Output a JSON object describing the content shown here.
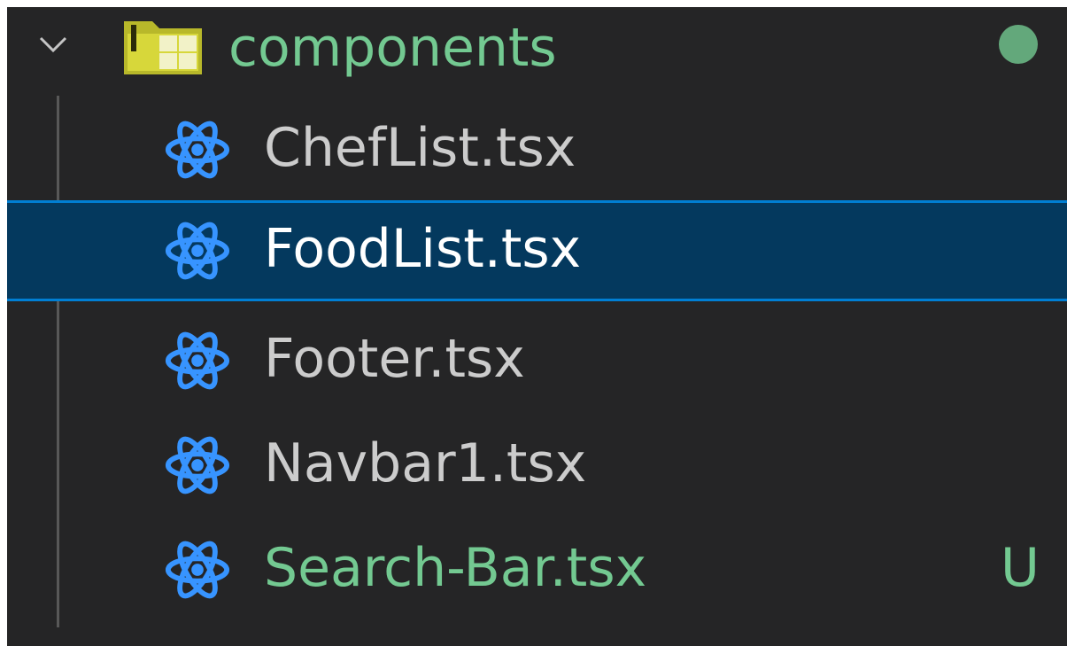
{
  "explorer": {
    "folder": {
      "name": "components",
      "expanded": true,
      "status_color": "#73c991",
      "chevron_icon": "chevron-down-icon",
      "folder_icon": "folder-components-icon"
    },
    "files": [
      {
        "name": "ChefList.tsx",
        "icon": "react-icon",
        "selected": false,
        "git_status": ""
      },
      {
        "name": "FoodList.tsx",
        "icon": "react-icon",
        "selected": true,
        "git_status": ""
      },
      {
        "name": "Footer.tsx",
        "icon": "react-icon",
        "selected": false,
        "git_status": ""
      },
      {
        "name": "Navbar1.tsx",
        "icon": "react-icon",
        "selected": false,
        "git_status": ""
      },
      {
        "name": "Search-Bar.tsx",
        "icon": "react-icon",
        "selected": false,
        "git_status": "U"
      }
    ],
    "colors": {
      "background": "#252526",
      "selection_background": "#04395e",
      "selection_border": "#007fd4",
      "untracked_text": "#73c991",
      "react_icon": "#3794ff"
    }
  }
}
